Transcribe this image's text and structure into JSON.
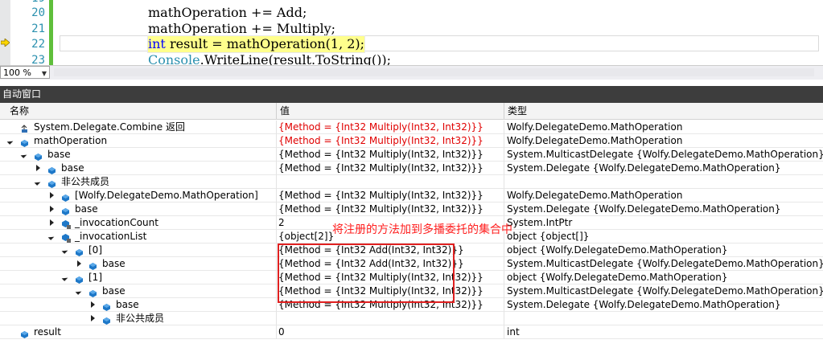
{
  "editor": {
    "lines": [
      {
        "no": "20",
        "text": "mathOperation += Add;"
      },
      {
        "no": "21",
        "text": "mathOperation += Multiply;"
      },
      {
        "no": "22",
        "kw": "int",
        "text": " result = mathOperation(1, 2);"
      },
      {
        "no": "23",
        "ty": "Console",
        "text": ".WriteLine(result.ToString());"
      }
    ]
  },
  "zoom": "100 %",
  "panel": {
    "title": "自动窗口",
    "columns": {
      "name": "名称",
      "value": "值",
      "type": "类型"
    }
  },
  "rows": [
    {
      "name": "System.Delegate.Combine 返回",
      "value": "{Method = {Int32 Multiply(Int32, Int32)}}",
      "type": "Wolfy.DelegateDemo.MathOperation",
      "level": 0,
      "exp": "none",
      "icon": "return-icon",
      "red": true
    },
    {
      "name": "mathOperation",
      "value": "{Method = {Int32 Multiply(Int32, Int32)}}",
      "type": "Wolfy.DelegateDemo.MathOperation",
      "level": 0,
      "exp": "open",
      "icon": "local-icon",
      "red": true
    },
    {
      "name": "base",
      "value": "{Method = {Int32 Multiply(Int32, Int32)}}",
      "type": "System.MulticastDelegate {Wolfy.DelegateDemo.MathOperation}",
      "level": 1,
      "exp": "open",
      "icon": "field-icon"
    },
    {
      "name": "base",
      "value": "{Method = {Int32 Multiply(Int32, Int32)}}",
      "type": "System.Delegate {Wolfy.DelegateDemo.MathOperation}",
      "level": 2,
      "exp": "closed",
      "icon": "field-icon"
    },
    {
      "name": "非公共成员",
      "value": "",
      "type": "",
      "level": 2,
      "exp": "open",
      "icon": "members-icon"
    },
    {
      "name": "[Wolfy.DelegateDemo.MathOperation]",
      "value": "{Method = {Int32 Multiply(Int32, Int32)}}",
      "type": "Wolfy.DelegateDemo.MathOperation",
      "level": 3,
      "exp": "closed",
      "icon": "field-icon"
    },
    {
      "name": "base",
      "value": "{Method = {Int32 Multiply(Int32, Int32)}}",
      "type": "System.Delegate {Wolfy.DelegateDemo.MathOperation}",
      "level": 3,
      "exp": "closed",
      "icon": "field-icon"
    },
    {
      "name": "_invocationCount",
      "value": "2",
      "type": "System.IntPtr",
      "level": 3,
      "exp": "closed",
      "icon": "private-field-icon"
    },
    {
      "name": "_invocationList",
      "value": "{object[2]}",
      "type": "object {object[]}",
      "level": 3,
      "exp": "open",
      "icon": "private-field-icon"
    },
    {
      "name": "[0]",
      "value": "{Method = {Int32 Add(Int32, Int32)}}",
      "type": "object {Wolfy.DelegateDemo.MathOperation}",
      "level": 4,
      "exp": "open",
      "icon": "field-icon"
    },
    {
      "name": "base",
      "value": "{Method = {Int32 Add(Int32, Int32)}}",
      "type": "System.MulticastDelegate {Wolfy.DelegateDemo.MathOperation}",
      "level": 5,
      "exp": "closed",
      "icon": "field-icon"
    },
    {
      "name": "[1]",
      "value": "{Method = {Int32 Multiply(Int32, Int32)}}",
      "type": "object {Wolfy.DelegateDemo.MathOperation}",
      "level": 4,
      "exp": "open",
      "icon": "field-icon"
    },
    {
      "name": "base",
      "value": "{Method = {Int32 Multiply(Int32, Int32)}}",
      "type": "System.MulticastDelegate {Wolfy.DelegateDemo.MathOperation}",
      "level": 5,
      "exp": "open",
      "icon": "field-icon"
    },
    {
      "name": "base",
      "value": "{Method = {Int32 Multiply(Int32, Int32)}}",
      "type": "System.Delegate {Wolfy.DelegateDemo.MathOperation}",
      "level": 6,
      "exp": "closed",
      "icon": "field-icon"
    },
    {
      "name": "非公共成员",
      "value": "",
      "type": "",
      "level": 6,
      "exp": "closed",
      "icon": "members-icon"
    },
    {
      "name": "result",
      "value": "0",
      "type": "int",
      "level": 0,
      "exp": "none",
      "icon": "field-icon"
    }
  ],
  "annotation": "将注册的方法加到多播委托的集合中",
  "colors": {
    "changed_value": "#e00000",
    "annotation": "#e02020",
    "panel_title_bg": "#3d3d3d",
    "highlight_line": "#ffff8c"
  }
}
